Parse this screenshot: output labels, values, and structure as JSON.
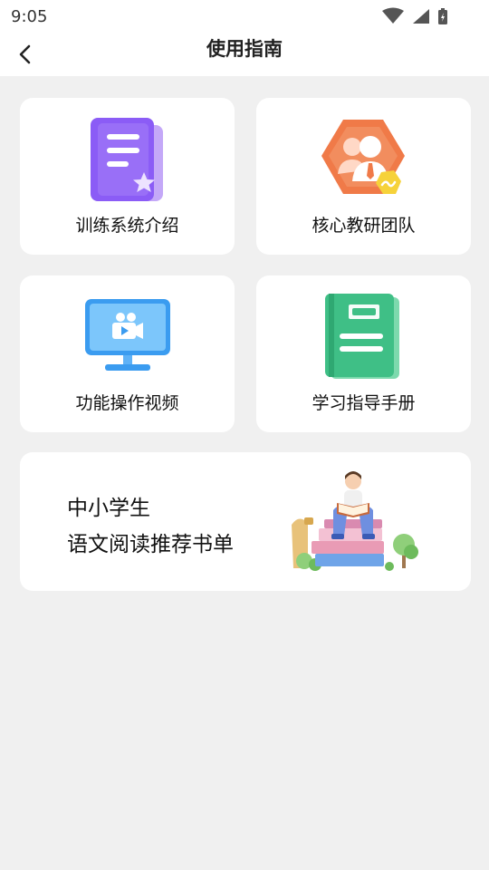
{
  "status_bar": {
    "time": "9:05",
    "icons": [
      "wifi-icon",
      "signal-icon",
      "battery-icon"
    ]
  },
  "header": {
    "back_icon": "chevron-left-icon",
    "title": "使用指南"
  },
  "cards": [
    {
      "label": "训练系统介绍",
      "icon": "document-star-icon",
      "color": "#8b5cf6"
    },
    {
      "label": "核心教研团队",
      "icon": "team-icon",
      "color": "#f07a48"
    },
    {
      "label": "功能操作视频",
      "icon": "monitor-video-icon",
      "color": "#3b9cf0"
    },
    {
      "label": "学习指导手册",
      "icon": "manual-book-icon",
      "color": "#3fbf86"
    }
  ],
  "recommendation": {
    "line1": "中小学生",
    "line2": "语文阅读推荐书单",
    "illustration": "reading-student-illustration"
  }
}
